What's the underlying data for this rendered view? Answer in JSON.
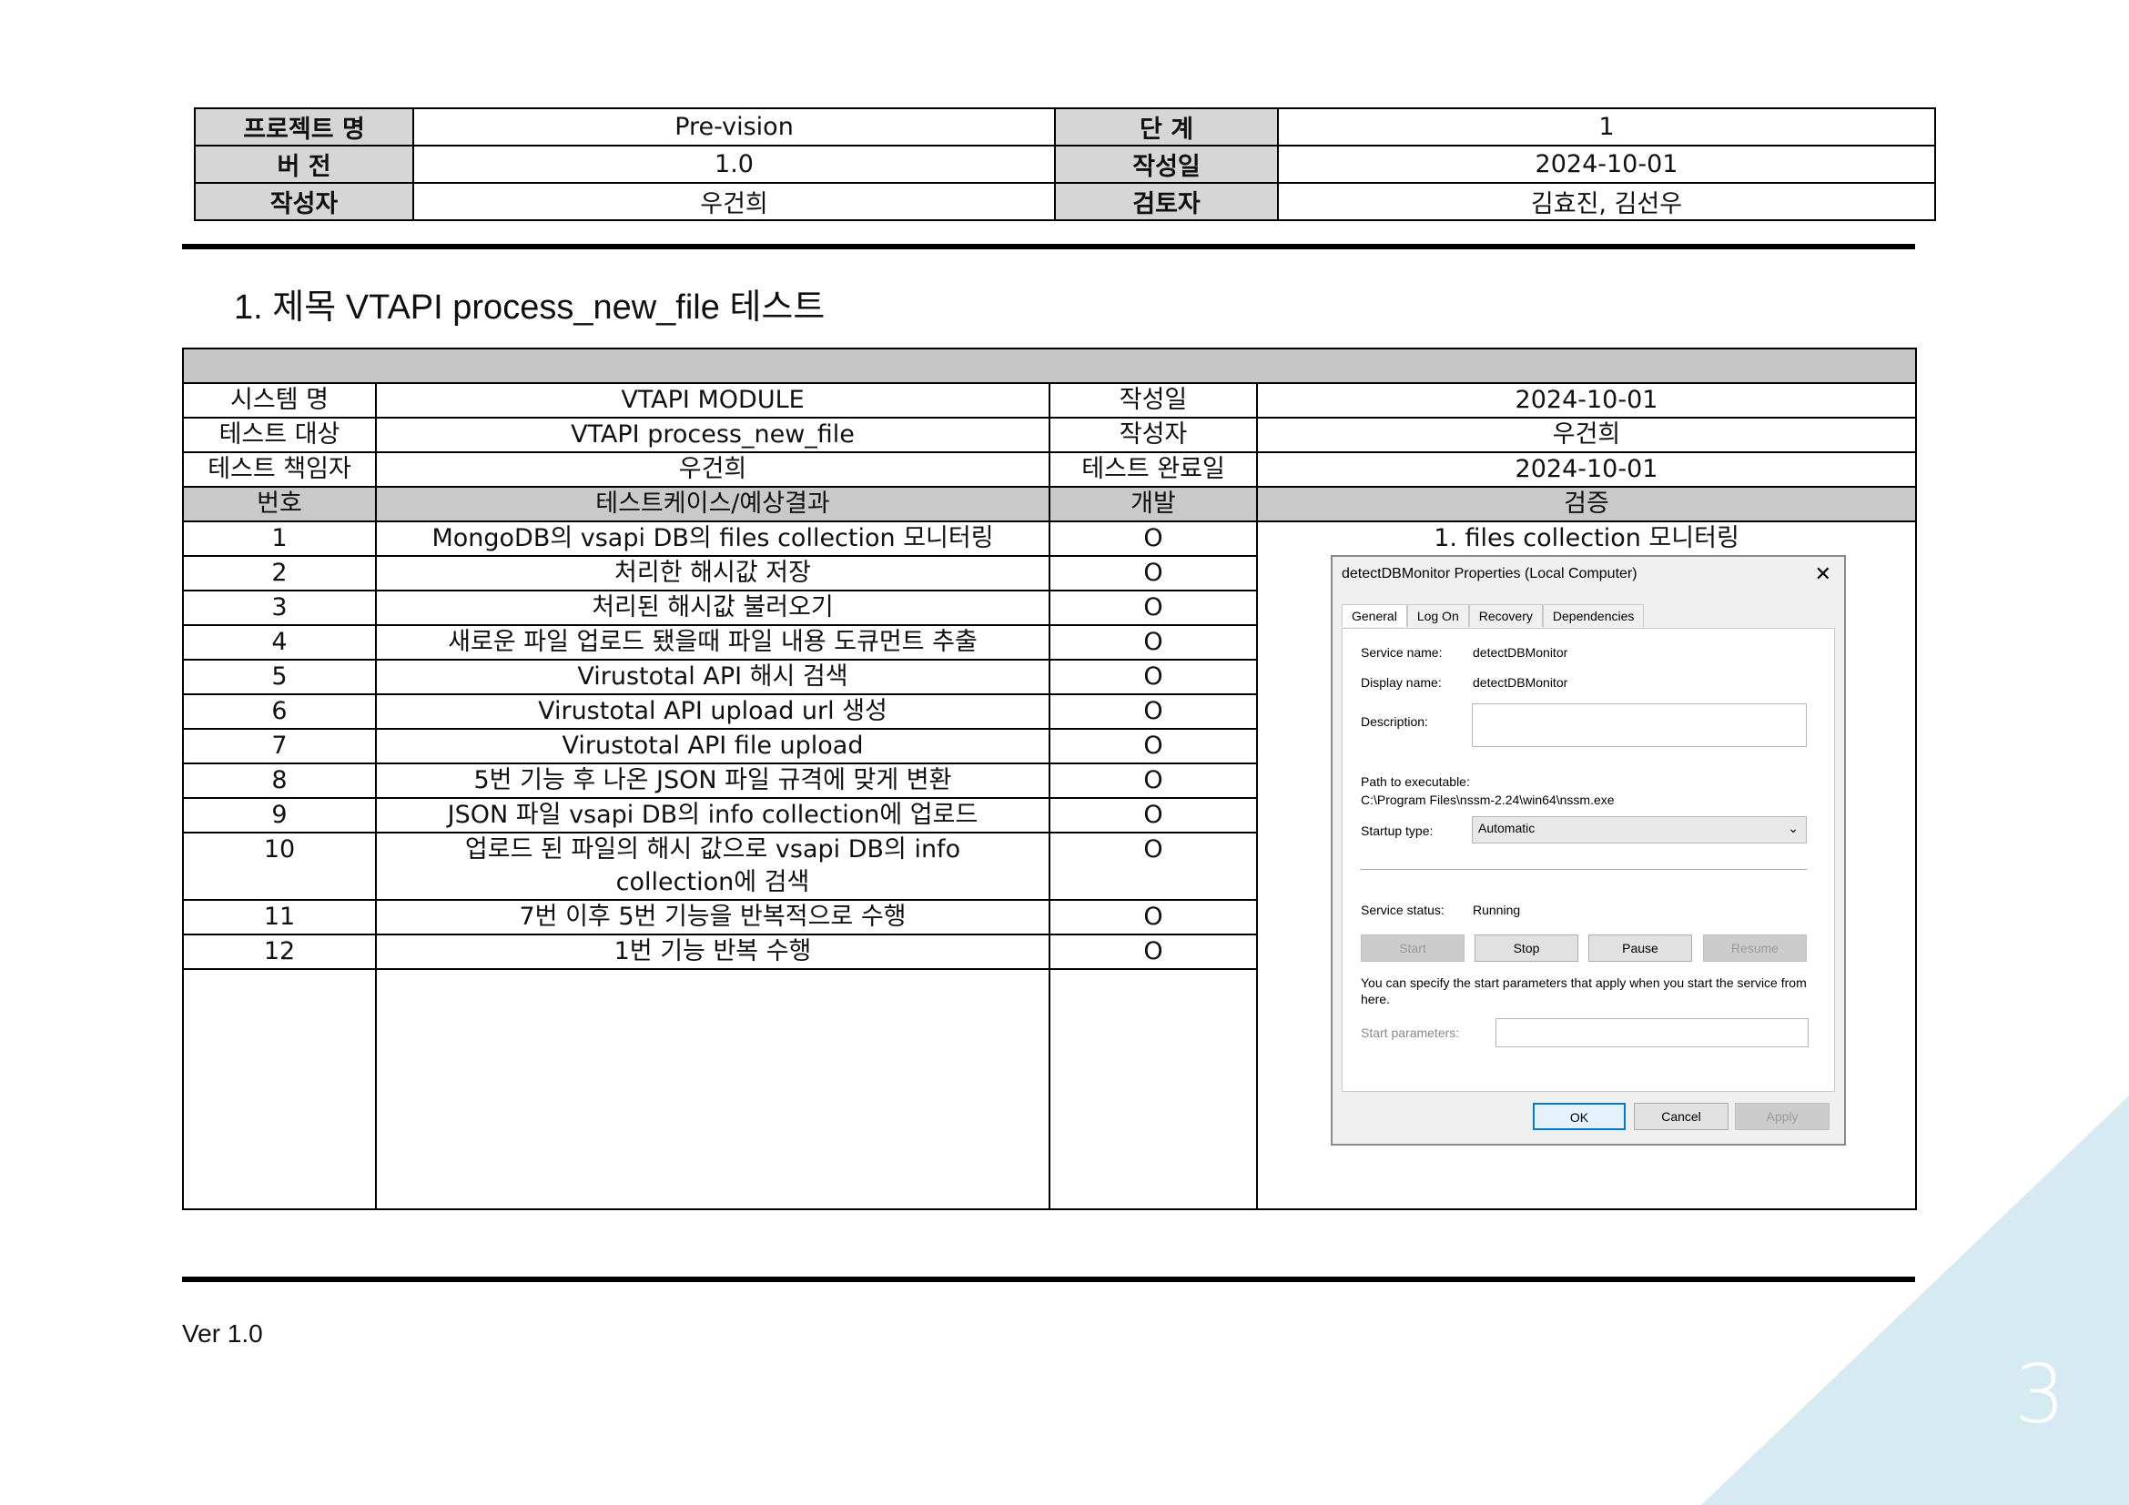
{
  "header": {
    "project_label": "프로젝트 명",
    "project_value": "Pre-vision",
    "stage_label": "단 계",
    "stage_value": "1",
    "version_label": "버 전",
    "version_value": "1.0",
    "created_label": "작성일",
    "created_value": "2024-10-01",
    "author_label": "작성자",
    "author_value": "우건희",
    "reviewer_label": "검토자",
    "reviewer_value": "김효진, 김선우"
  },
  "title": "1. 제목 VTAPI process_new_file 테스트",
  "info": {
    "system_label": "시스템 명",
    "system_value": "VTAPI MODULE",
    "created_label": "작성일",
    "created_value": "2024-10-01",
    "target_label": "테스트 대상",
    "target_value": "VTAPI process_new_file",
    "author_label": "작성자",
    "author_value": "우건희",
    "owner_label": "테스트 책임자",
    "owner_value": "우건희",
    "done_label": "테스트 완료일",
    "done_value": "2024-10-01"
  },
  "columns": {
    "no": "번호",
    "case": "테스트케이스/예상결과",
    "dev": "개발",
    "verify": "검증"
  },
  "cases": [
    {
      "no": "1",
      "text": "MongoDB의 vsapi DB의 files collection 모니터링",
      "dev": "O"
    },
    {
      "no": "2",
      "text": "처리한 해시값 저장",
      "dev": "O"
    },
    {
      "no": "3",
      "text": "처리된 해시값 불러오기",
      "dev": "O"
    },
    {
      "no": "4",
      "text": "새로운 파일 업로드 됐을때 파일 내용 도큐먼트 추출",
      "dev": "O"
    },
    {
      "no": "5",
      "text": "Virustotal API 해시 검색",
      "dev": "O"
    },
    {
      "no": "6",
      "text": "Virustotal API upload url 생성",
      "dev": "O"
    },
    {
      "no": "7",
      "text": "Virustotal API file upload",
      "dev": "O"
    },
    {
      "no": "8",
      "text": "5번 기능 후 나온 JSON 파일 규격에 맞게 변환",
      "dev": "O"
    },
    {
      "no": "9",
      "text": "JSON 파일 vsapi DB의 info collection에 업로드",
      "dev": "O"
    },
    {
      "no": "10",
      "text": "업로드 된 파일의 해시 값으로 vsapi DB의 info collection에 검색",
      "dev": "O"
    },
    {
      "no": "11",
      "text": "7번 이후 5번 기능을 반복적으로 수행",
      "dev": "O"
    },
    {
      "no": "12",
      "text": "1번 기능 반복 수행",
      "dev": "O"
    }
  ],
  "verify_heading": "1. files collection 모니터링",
  "dialog": {
    "title": "detectDBMonitor Properties (Local Computer)",
    "tabs": [
      "General",
      "Log On",
      "Recovery",
      "Dependencies"
    ],
    "service_name_label": "Service name:",
    "service_name_value": "detectDBMonitor",
    "display_name_label": "Display name:",
    "display_name_value": "detectDBMonitor",
    "description_label": "Description:",
    "path_label": "Path to executable:",
    "path_value": "C:\\Program Files\\nssm-2.24\\win64\\nssm.exe",
    "startup_label": "Startup type:",
    "startup_value": "Automatic",
    "status_label": "Service status:",
    "status_value": "Running",
    "btn_start": "Start",
    "btn_stop": "Stop",
    "btn_pause": "Pause",
    "btn_resume": "Resume",
    "hint": "You can specify the start parameters that apply when you start the service from here.",
    "start_params_label": "Start parameters:",
    "btn_ok": "OK",
    "btn_cancel": "Cancel",
    "btn_apply": "Apply"
  },
  "footer_version": "Ver 1.0",
  "page_number": "3"
}
